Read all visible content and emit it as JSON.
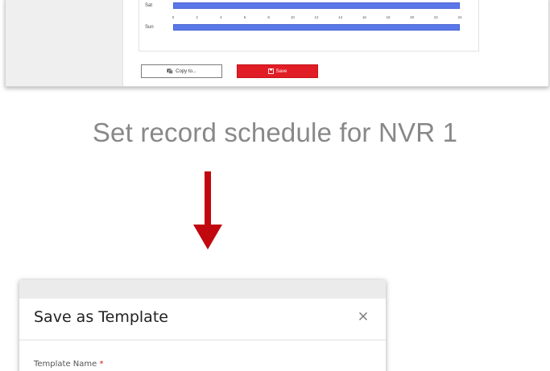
{
  "schedule": {
    "days": [
      {
        "label": "Sat"
      },
      {
        "label": "Sun"
      }
    ],
    "hour_ticks": [
      "0",
      "2",
      "4",
      "6",
      "8",
      "10",
      "12",
      "14",
      "16",
      "18",
      "20",
      "22",
      "24"
    ],
    "bar_color": "#5b78e8"
  },
  "buttons": {
    "copy_label": "Copy to...",
    "save_label": "Save"
  },
  "caption": "Set record schedule for NVR 1",
  "arrow_color": "#c0080e",
  "dialog": {
    "title": "Save as Template",
    "close_symbol": "×",
    "field_label": "Template Name",
    "required_mark": "*"
  },
  "colors": {
    "save_button": "#e11d25",
    "caption_text": "#888888"
  }
}
